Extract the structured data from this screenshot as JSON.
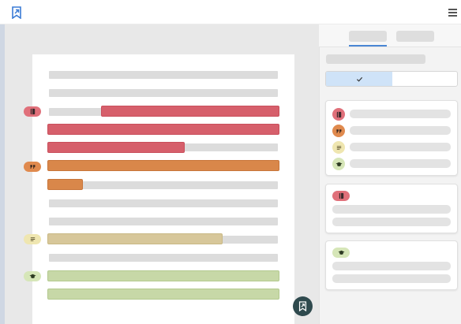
{
  "colors": {
    "accent": "#4a86d4",
    "quote_red": "#d65f6b",
    "quote_orange": "#d9874a",
    "note_yellow": "#d7c79a",
    "learn_green": "#c7d8a7",
    "fab": "#2f4a4e"
  },
  "toolbar": {
    "logo_icon": "bookmark-arrow-icon",
    "menu_icon": "hamburger-menu-icon"
  },
  "sidebar": {
    "toggle": {
      "selected_icon": "check-icon"
    },
    "categories": [
      {
        "key": "book",
        "icon": "book-icon",
        "color": "red"
      },
      {
        "key": "quote",
        "icon": "quote-icon",
        "color": "orange"
      },
      {
        "key": "note",
        "icon": "note-lines-icon",
        "color": "yellow"
      },
      {
        "key": "learn",
        "icon": "graduation-cap-icon",
        "color": "green"
      }
    ]
  },
  "document": {
    "markers": [
      {
        "icon": "book-icon",
        "color": "red"
      },
      {
        "icon": "quote-icon",
        "color": "orange"
      },
      {
        "icon": "note-lines-icon",
        "color": "yellow"
      },
      {
        "icon": "graduation-cap-icon",
        "color": "green"
      }
    ]
  },
  "fab": {
    "icon": "bookmark-arrow-icon"
  }
}
